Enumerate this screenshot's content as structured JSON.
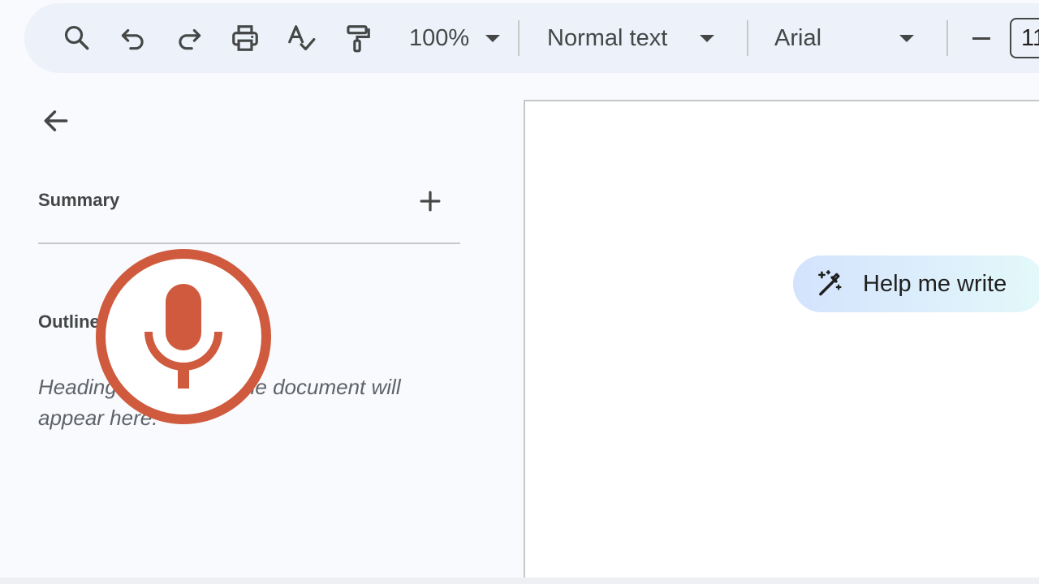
{
  "toolbar": {
    "zoom_value": "100%",
    "paragraph_style": "Normal text",
    "font_family": "Arial",
    "font_size": "11"
  },
  "sidebar": {
    "summary_label": "Summary",
    "outline_label": "Outline",
    "outline_hint": "Headings you add to the document will appear here."
  },
  "document": {
    "help_me_write_label": "Help me write"
  },
  "colors": {
    "toolbar_bg": "#edf2fa",
    "mic_accent": "#cf5a3e",
    "help_me_write_gradient_start": "#d3e3fd"
  },
  "icons": {
    "search": "search-icon",
    "undo": "undo-icon",
    "redo": "redo-icon",
    "print": "print-icon",
    "spellcheck": "spellcheck-icon",
    "paint_format": "paint-format-icon",
    "back": "arrow-back-icon",
    "add": "plus-icon",
    "help_me_write": "magic-pencil-icon",
    "mic": "microphone-icon"
  }
}
